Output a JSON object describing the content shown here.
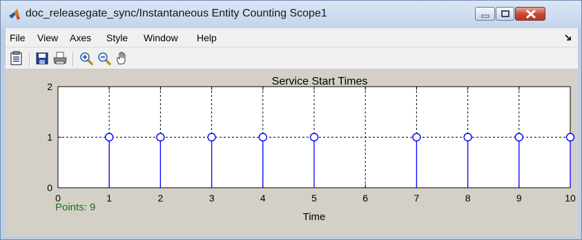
{
  "window": {
    "title": "doc_releasegate_sync/Instantaneous Entity Counting Scope1"
  },
  "menu": {
    "items": [
      "File",
      "View",
      "Axes",
      "Style",
      "Window",
      "Help"
    ]
  },
  "toolbar": {
    "tools": [
      "parameters-icon",
      "save-icon",
      "print-icon",
      "zoom-in-icon",
      "zoom-out-icon",
      "pan-icon"
    ]
  },
  "status": {
    "points": "Points: 9"
  },
  "chart_data": {
    "type": "scatter",
    "title": "Service Start Times",
    "xlabel": "Time",
    "ylabel": "",
    "xlim": [
      0,
      10
    ],
    "ylim": [
      0,
      2
    ],
    "x_ticks": [
      "0",
      "1",
      "2",
      "3",
      "4",
      "5",
      "6",
      "7",
      "8",
      "9",
      "10"
    ],
    "y_ticks": [
      "0",
      "1",
      "2"
    ],
    "grid": true,
    "series": [
      {
        "style": "stem",
        "color": "#0000ff",
        "x": [
          1,
          2,
          3,
          4,
          5,
          7,
          8,
          9,
          10
        ],
        "y": [
          1,
          1,
          1,
          1,
          1,
          1,
          1,
          1,
          1
        ]
      }
    ]
  },
  "colors": {
    "titlebar": "#c3d4ea",
    "close_button": "#c8452f",
    "figure_background": "#d4d0c8",
    "axes_background": "#ffffff",
    "series": "#0000ff",
    "points_text": "#1d6e1d"
  }
}
